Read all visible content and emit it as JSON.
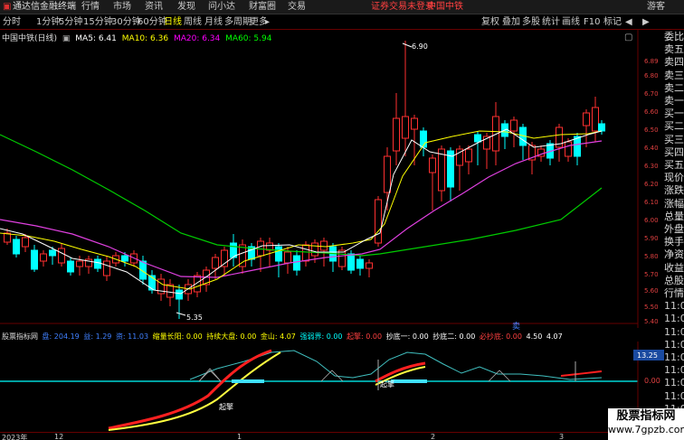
{
  "app": {
    "title": "通达信金融终端",
    "menus": [
      "行情",
      "市场",
      "资讯",
      "发现",
      "问小达",
      "财富圈",
      "交易"
    ],
    "warn": "证券交易未登录",
    "stock_tab": "中国中铁",
    "guest": "游客"
  },
  "toolbar": {
    "periods": [
      "分时",
      "1分钟",
      "5分钟",
      "15分钟",
      "30分钟",
      "60分钟",
      "日线",
      "周线",
      "月线",
      "多周期",
      "更多"
    ],
    "active": "日线",
    "right": [
      "复权",
      "叠加",
      "多股",
      "统计",
      "画线",
      "F10",
      "标记"
    ]
  },
  "chart": {
    "title": "中国中铁(日线)",
    "ma": [
      {
        "label": "MA5: 6.41",
        "color": "#ffffff"
      },
      {
        "label": "MA10: 6.36",
        "color": "#ffff00"
      },
      {
        "label": "MA20: 6.34",
        "color": "#ff00ff"
      },
      {
        "label": "MA60: 5.94",
        "color": "#00ff00"
      }
    ],
    "y_ticks": [
      "6.89",
      "6.80",
      "6.70",
      "6.60",
      "6.50",
      "6.40",
      "6.30",
      "6.20",
      "6.10",
      "6.00",
      "5.90",
      "5.80",
      "5.70",
      "5.60",
      "5.50",
      "5.40"
    ],
    "high": "6.90",
    "low": "5.35",
    "sell_marker": "卖",
    "x_labels": [
      "2023年",
      "12",
      "1",
      "2",
      "3"
    ]
  },
  "right_panel": {
    "items": [
      "委比",
      "卖五",
      "卖四",
      "卖三",
      "卖二",
      "卖一",
      "买一",
      "买二",
      "买三",
      "买四",
      "买五",
      "现价",
      "涨跌",
      "涨幅",
      "总量",
      "外盘",
      "换手",
      "净资",
      "收益",
      "总股",
      "行情",
      "11:0",
      "11:0",
      "11:0",
      "11:0",
      "11:0",
      "11:0",
      "11:0",
      "11:0",
      "11:0",
      "11:0",
      "11:0"
    ]
  },
  "indicator": {
    "name": "股票指标网",
    "fields": [
      {
        "t": "盘: 204.19",
        "c": "#4080ff"
      },
      {
        "t": "益: 1.29",
        "c": "#4080ff"
      },
      {
        "t": "资: 11.03",
        "c": "#4080ff"
      },
      {
        "t": "缩量长阳: 0.00",
        "c": "#ffff00"
      },
      {
        "t": "持续大盘: 0.00",
        "c": "#ffff00"
      },
      {
        "t": "金山: 4.07",
        "c": "#ffff00"
      },
      {
        "t": "强弱界: 0.00",
        "c": "#00ffff"
      },
      {
        "t": "起擎: 0.00",
        "c": "#ff4040"
      },
      {
        "t": "抄底一: 0.00",
        "c": "#ffffff"
      },
      {
        "t": "抄底二: 0.00",
        "c": "#ffffff"
      },
      {
        "t": "必抄底: 0.00",
        "c": "#ff4040"
      },
      {
        "t": "4.50",
        "c": "#ffffff"
      },
      {
        "t": "4.07",
        "c": "#ffffff"
      }
    ],
    "scale": [
      "13.25",
      "0.00"
    ],
    "label_qiqing": "起擎"
  },
  "watermark": {
    "line1": "股票指标网",
    "line2": "www.7gpzb.com"
  }
}
